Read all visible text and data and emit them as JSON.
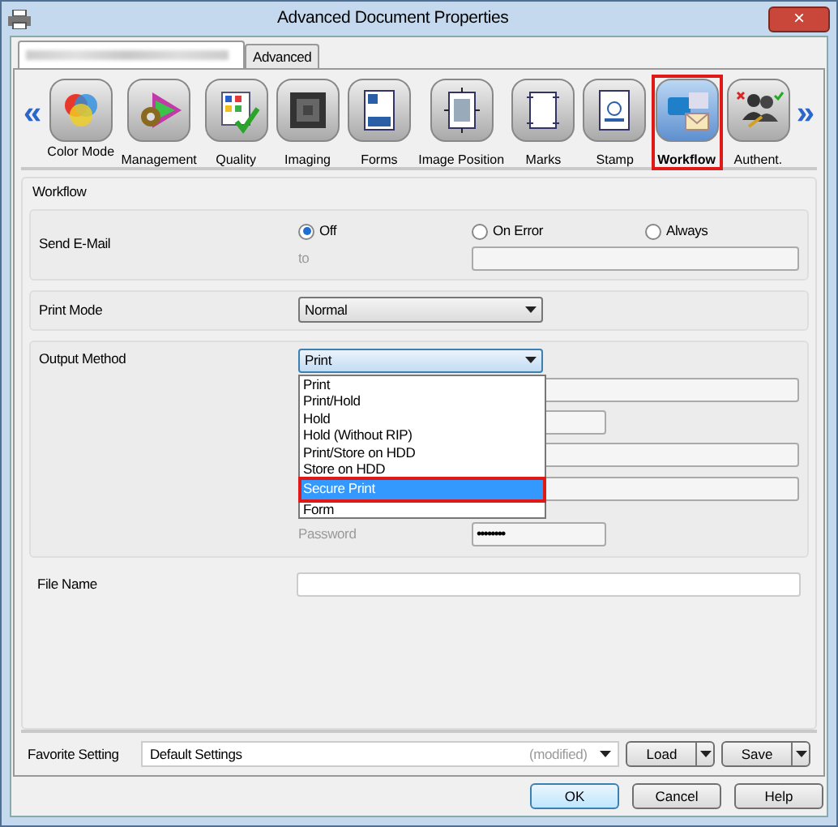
{
  "window": {
    "title": "Advanced Document Properties",
    "close": "×"
  },
  "tabs": [
    {
      "kind": "blurred",
      "selected": true
    },
    {
      "kind": "text",
      "label": "Advanced",
      "selected": false
    }
  ],
  "categories": {
    "prev": "«",
    "next": "»",
    "items": [
      {
        "kind": "color",
        "label": "Color Mode",
        "selected": false
      },
      {
        "kind": "management",
        "label": "Management",
        "selected": false
      },
      {
        "kind": "quality",
        "label": "Quality",
        "selected": false
      },
      {
        "kind": "imaging",
        "label": "Imaging",
        "selected": false
      },
      {
        "kind": "forms",
        "label": "Forms",
        "selected": false
      },
      {
        "kind": "position",
        "label": "Image Position",
        "selected": false
      },
      {
        "kind": "marks",
        "label": "Marks",
        "selected": false
      },
      {
        "kind": "stamp",
        "label": "Stamp",
        "selected": false
      },
      {
        "kind": "workflow",
        "label": "Workflow",
        "selected": true
      },
      {
        "kind": "authent",
        "label": "Authent.",
        "selected": false
      }
    ]
  },
  "group": {
    "title": "Workflow"
  },
  "send_email": {
    "label": "Send E-Mail",
    "options": [
      {
        "label": "Off",
        "selected": true
      },
      {
        "label": "On Error",
        "selected": false
      },
      {
        "label": "Always",
        "selected": false
      }
    ],
    "to_label": "to"
  },
  "print_mode": {
    "label": "Print Mode",
    "value": "Normal"
  },
  "output_method": {
    "label": "Output Method",
    "value": "Print",
    "options": [
      {
        "label": "Print",
        "highlighted": false
      },
      {
        "label": "Print/Hold",
        "highlighted": false
      },
      {
        "label": "Hold",
        "highlighted": false
      },
      {
        "label": "Hold (Without RIP)",
        "highlighted": false
      },
      {
        "label": "Print/Store on HDD",
        "highlighted": false
      },
      {
        "label": "Store on HDD",
        "highlighted": false
      },
      {
        "label": "Secure Print",
        "highlighted": true
      },
      {
        "label": "Form",
        "highlighted": false
      }
    ],
    "fields": [
      {
        "kind": "wide"
      },
      {
        "kind": "short"
      },
      {
        "kind": "wide"
      },
      {
        "kind": "wide"
      },
      {
        "kind": "password",
        "label": "Password",
        "value": "••••••••"
      }
    ]
  },
  "file_name": {
    "label": "File Name"
  },
  "favorite": {
    "label": "Favorite Setting",
    "value": "Default Settings",
    "note": "(modified)",
    "buttons": [
      "Load",
      "Save"
    ]
  },
  "buttons": [
    {
      "label": "OK",
      "kind": "default"
    },
    {
      "label": "Cancel",
      "kind": "normal"
    },
    {
      "label": "Help",
      "kind": "normal"
    }
  ]
}
